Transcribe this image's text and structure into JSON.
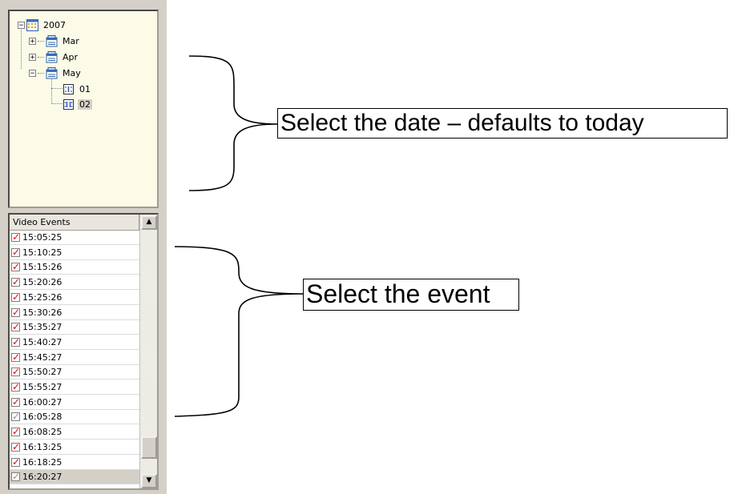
{
  "tree": {
    "year": "2007",
    "months": [
      {
        "label": "Mar",
        "expander": "+"
      },
      {
        "label": "Apr",
        "expander": "+"
      },
      {
        "label": "May",
        "expander": "−"
      }
    ],
    "year_expander": "−",
    "days": [
      {
        "label": "01",
        "selected": false
      },
      {
        "label": "02",
        "selected": true
      }
    ]
  },
  "events": {
    "header": "Video Events",
    "scroll_up": "▲",
    "scroll_down": "▼",
    "items": [
      {
        "time": "15:05:25",
        "checked": true
      },
      {
        "time": "15:10:25",
        "checked": true
      },
      {
        "time": "15:15:26",
        "checked": true
      },
      {
        "time": "15:20:26",
        "checked": true
      },
      {
        "time": "15:25:26",
        "checked": true
      },
      {
        "time": "15:30:26",
        "checked": true
      },
      {
        "time": "15:35:27",
        "checked": true
      },
      {
        "time": "15:40:27",
        "checked": true
      },
      {
        "time": "15:45:27",
        "checked": true
      },
      {
        "time": "15:50:27",
        "checked": true
      },
      {
        "time": "15:55:27",
        "checked": true
      },
      {
        "time": "16:00:27",
        "checked": true
      },
      {
        "time": "16:05:28",
        "checked": false
      },
      {
        "time": "16:08:25",
        "checked": true
      },
      {
        "time": "16:13:25",
        "checked": true
      },
      {
        "time": "16:18:25",
        "checked": true
      },
      {
        "time": "16:20:27",
        "checked": false,
        "selected": true
      }
    ]
  },
  "annotations": {
    "date_callout": "Select the date – defaults to today",
    "event_callout": "Select the event"
  }
}
